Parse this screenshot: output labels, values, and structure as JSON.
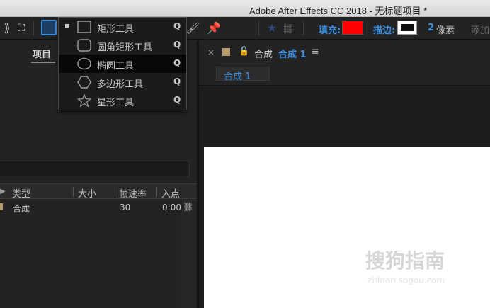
{
  "window": {
    "title": "Adobe After Effects CC 2018 - 无标题项目 *"
  },
  "toolbar": {
    "fill_label": "填充:",
    "fill_color": "#ff0000",
    "stroke_label": "描边:",
    "stroke_color": "#ffffff",
    "stroke_width": "2",
    "stroke_unit": "像素",
    "add_label": "添加"
  },
  "shape_menu": {
    "items": [
      {
        "label": "矩形工具",
        "shortcut": "Q",
        "icon": "rectangle-icon"
      },
      {
        "label": "圆角矩形工具",
        "shortcut": "Q",
        "icon": "rounded-rectangle-icon"
      },
      {
        "label": "椭圆工具",
        "shortcut": "Q",
        "icon": "ellipse-icon"
      },
      {
        "label": "多边形工具",
        "shortcut": "Q",
        "icon": "polygon-icon"
      },
      {
        "label": "星形工具",
        "shortcut": "Q",
        "icon": "star-icon"
      }
    ]
  },
  "project_panel": {
    "tab": "项目",
    "columns": [
      "类型",
      "大小",
      "帧速率",
      "入点"
    ],
    "rows": [
      {
        "type": "合成",
        "size": "",
        "fps": "30",
        "in": "0:00:"
      }
    ]
  },
  "comp_panel": {
    "tab_prefix": "合成",
    "tab_name": "合成 1",
    "breadcrumb": "合成 1"
  },
  "watermark": {
    "text": "搜狗指南",
    "sub": "zhinan.sogou.com"
  }
}
